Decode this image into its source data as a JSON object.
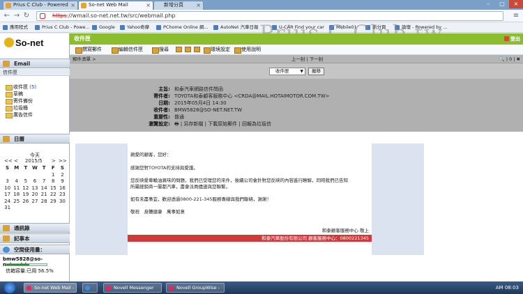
{
  "browser": {
    "tabs": [
      {
        "title": "Prius C Club - Powered"
      },
      {
        "title": "So-net Web Mail"
      },
      {
        "title": "新增分頁"
      }
    ],
    "url_scheme": "https",
    "url_rest": "://wmail.so-net.net.tw/src/webmail.php",
    "bookmarks": [
      "應用程式",
      "Prius C Club - Powe...",
      "Google",
      "Yahoo奇摩",
      "PChome Online 網...",
      "AutoNet 汽車日報",
      "U-CAR Find your car",
      "Mobile01",
      "新分頁",
      "論壇 - Powered by ..."
    ]
  },
  "watermark": "Prius-C-Club.tw",
  "sidebar": {
    "logo": "So-net",
    "email_title": "Email",
    "inbox_header": "信件匣",
    "folders": [
      {
        "name": "收件匣",
        "count": "(5)"
      },
      {
        "name": "草稿",
        "count": ""
      },
      {
        "name": "寄件備份",
        "count": ""
      },
      {
        "name": "垃圾桶",
        "count": ""
      },
      {
        "name": "廣告信件",
        "count": ""
      }
    ],
    "calendar_title": "日曆",
    "calendar_today": "今天",
    "calendar_month": "2015/5",
    "calendar_prev": "<<",
    "calendar_prev1": "<",
    "calendar_next1": ">",
    "calendar_next": ">>",
    "weekdays": [
      "S",
      "M",
      "T",
      "W",
      "T",
      "F",
      "S"
    ],
    "days": [
      "",
      "",
      "",
      "",
      "",
      "1",
      "2",
      "3",
      "4",
      "5",
      "6",
      "7",
      "8",
      "9",
      "10",
      "11",
      "12",
      "13",
      "14",
      "15",
      "16",
      "17",
      "18",
      "19",
      "20",
      "21",
      "22",
      "23",
      "24",
      "25",
      "26",
      "27",
      "28",
      "29",
      "30",
      "31",
      "",
      "",
      "",
      "",
      "",
      ""
    ],
    "contacts": "通訊錄",
    "notes": "記事本",
    "usage_title": "空間使用量：",
    "usage_user": "bmw5828@so-net.net.tw",
    "usage_text": "信箱容量:已用 56.5%",
    "usage_fraction": 0.565
  },
  "main": {
    "title": "收件匣",
    "logout": "登出",
    "toolbar": [
      "撰寫郵件",
      "編輯信件匣",
      "搜尋",
      "環境設定",
      "使用說明"
    ],
    "path": "郵件清單",
    "pager_prev": "上一封",
    "pager_next": "下一封",
    "icons_text": "| 0 |",
    "folder_select": "收件匣",
    "move_button": "搬移",
    "header": {
      "subject_label": "主旨:",
      "subject": "和泰汽車網路信件問函",
      "from_label": "寄件者:",
      "from": "TOYOTA和泰顧客服務中心 <CRDA@MAIL.HOTAIMOTOR.COM.TW>",
      "date_label": "日期:",
      "date": "2015年05月4日 14:30",
      "to_label": "收件者:",
      "to": "BMW5828@SO-NET.NET.TW",
      "priority_label": "重要性:",
      "priority": "普通",
      "options_label": "瀏覽設定:",
      "options": "| 另存新檔 | 下載原始郵件 | 回報為垃圾信"
    },
    "body": {
      "greeting": "親愛的顧客，您好：",
      "p1": "感謝您對TOYOTA的支持與愛護。",
      "p2a": "您反映愛車輪油異味的問題，我們已受理您的來件，後續公司會針對您反映的內容進行瞭解，同時我們已告知",
      "p2b": "所屬經銷商一蘭都汽車，盡會派員儘速與您聯繫。",
      "p3": "如有未盡事宜，歡迎透過0800-221-345服務專線與我們聯絡，謝謝！",
      "closing": "敬祝　身體健康　萬事如意",
      "signature": "和泰顧客服務中心 敬上",
      "footer": "和泰汽車股份有限公司 顧客服務中心：0800221345"
    }
  },
  "taskbar": {
    "tasks": [
      "So-net Web Mail -",
      "Novell Messenger",
      "Novell GroupWise -"
    ],
    "clock": "AM 08:03"
  }
}
